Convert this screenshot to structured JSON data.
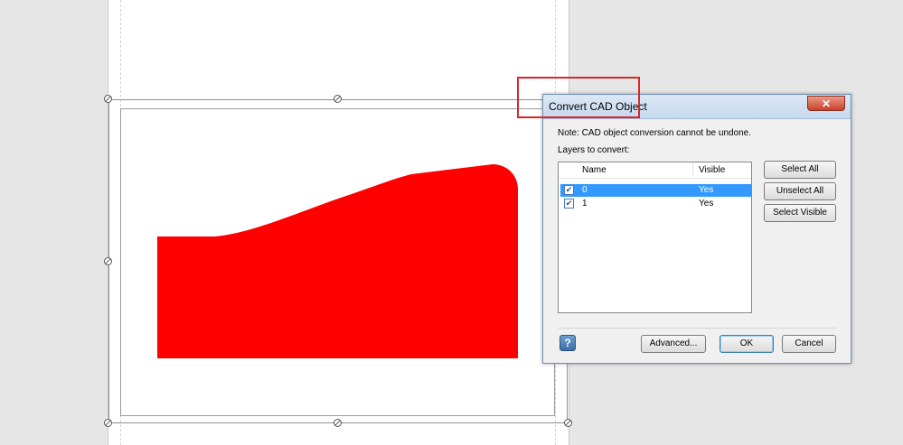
{
  "dialog": {
    "title": "Convert CAD Object",
    "close_label": "✕",
    "note": "Note: CAD object conversion cannot be undone.",
    "layers_label": "Layers to convert:",
    "columns": {
      "name": "Name",
      "visible": "Visible"
    },
    "layers": [
      {
        "name": "0",
        "visible": "Yes",
        "checked": true,
        "selected": true
      },
      {
        "name": "1",
        "visible": "Yes",
        "checked": true,
        "selected": false
      }
    ],
    "buttons": {
      "select_all": "Select All",
      "unselect_all": "Unselect All",
      "select_visible": "Select Visible",
      "advanced": "Advanced...",
      "ok": "OK",
      "cancel": "Cancel",
      "help": "?"
    }
  },
  "canvas": {
    "shape_color": "#ff0000",
    "highlight_color": "#d9262a"
  },
  "icons": {
    "checkbox": "checkmark-icon",
    "help": "help-icon",
    "close": "close-icon"
  }
}
